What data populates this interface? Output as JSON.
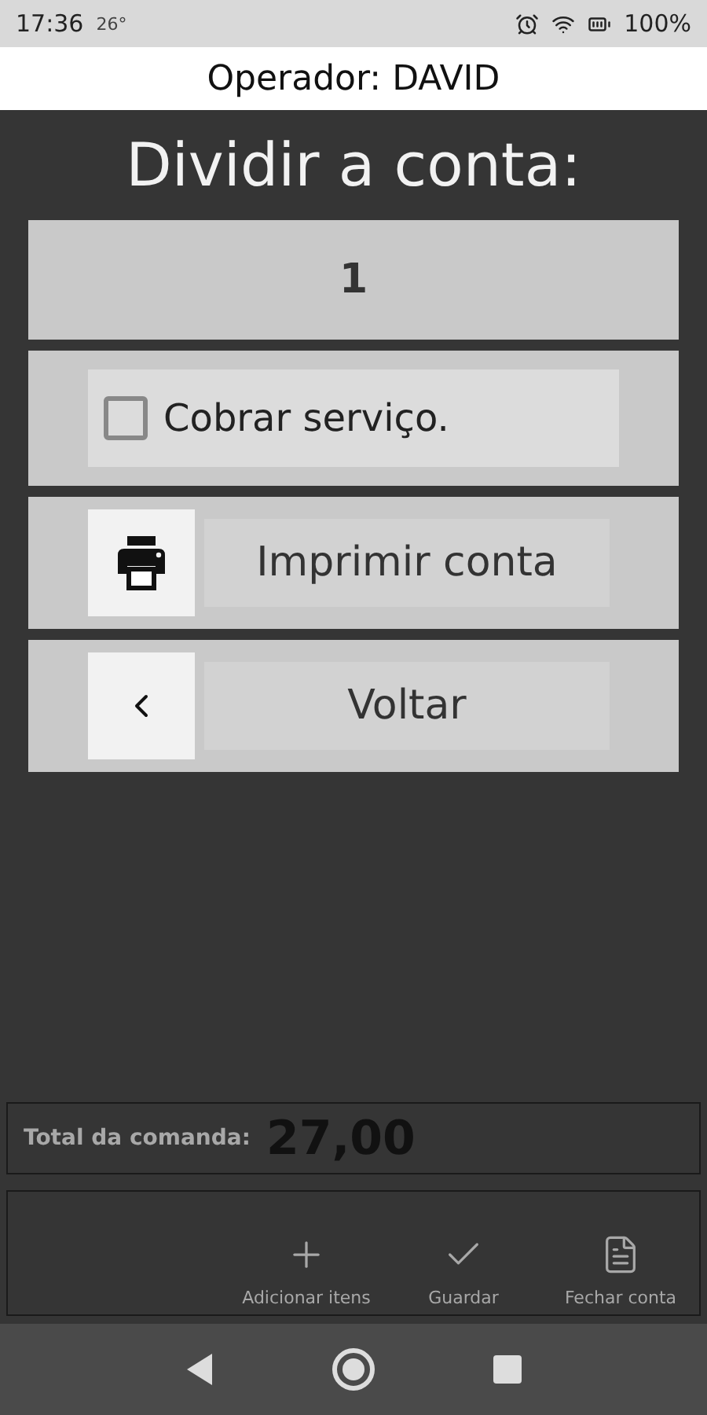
{
  "status_bar": {
    "time": "17:36",
    "temperature": "26°",
    "battery": "100%"
  },
  "header": {
    "title": "Operador: DAVID"
  },
  "dialog": {
    "title": "Dividir a conta:",
    "split_count": "1",
    "service_checkbox": {
      "label": "Cobrar serviço.",
      "checked": false
    },
    "buttons": [
      {
        "kind": "print",
        "label": "Imprimir conta"
      },
      {
        "kind": "back",
        "label": "Voltar"
      }
    ]
  },
  "total": {
    "label": "Total da comanda:",
    "value": "27,00"
  },
  "actions": [
    {
      "kind": "add",
      "label": "Adicionar itens"
    },
    {
      "kind": "save",
      "label": "Guardar"
    },
    {
      "kind": "close",
      "label": "Fechar conta"
    }
  ]
}
